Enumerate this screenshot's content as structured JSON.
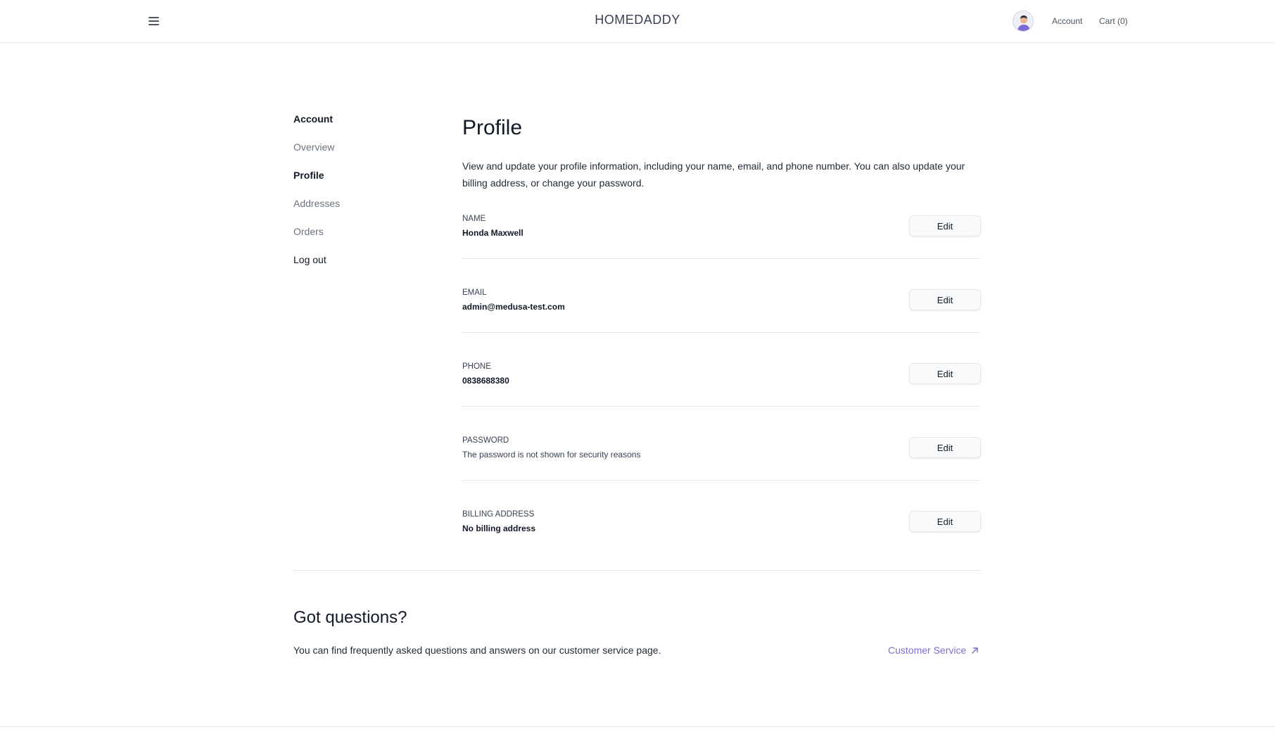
{
  "header": {
    "brand": "HOMEDADDY",
    "account_link": "Account",
    "cart_link": "Cart (0)",
    "menu_icon": "hamburger-icon",
    "avatar_icon": "user-avatar-icon"
  },
  "sidebar": {
    "title": "Account",
    "items": [
      {
        "label": "Overview"
      },
      {
        "label": "Profile"
      },
      {
        "label": "Addresses"
      },
      {
        "label": "Orders"
      },
      {
        "label": "Log out"
      }
    ],
    "active": "Profile"
  },
  "main": {
    "title": "Profile",
    "description": "View and update your profile information, including your name, email, and phone number. You can also update your billing address, or change your password.",
    "fields": [
      {
        "label": "NAME",
        "value": "Honda Maxwell",
        "button": "Edit"
      },
      {
        "label": "EMAIL",
        "value": "admin@medusa-test.com",
        "button": "Edit"
      },
      {
        "label": "PHONE",
        "value": "0838688380",
        "button": "Edit"
      },
      {
        "label": "PASSWORD",
        "value": "The password is not shown for security reasons",
        "button": "Edit"
      },
      {
        "label": "BILLING ADDRESS",
        "value": "No billing address",
        "button": "Edit"
      }
    ]
  },
  "help": {
    "title": "Got questions?",
    "text": "You can find frequently asked questions and answers on our customer service page.",
    "link_label": "Customer Service",
    "link_icon": "arrow-up-right-icon"
  },
  "colors": {
    "link_accent": "#7c6fd0",
    "divider": "#e5e7eb"
  }
}
